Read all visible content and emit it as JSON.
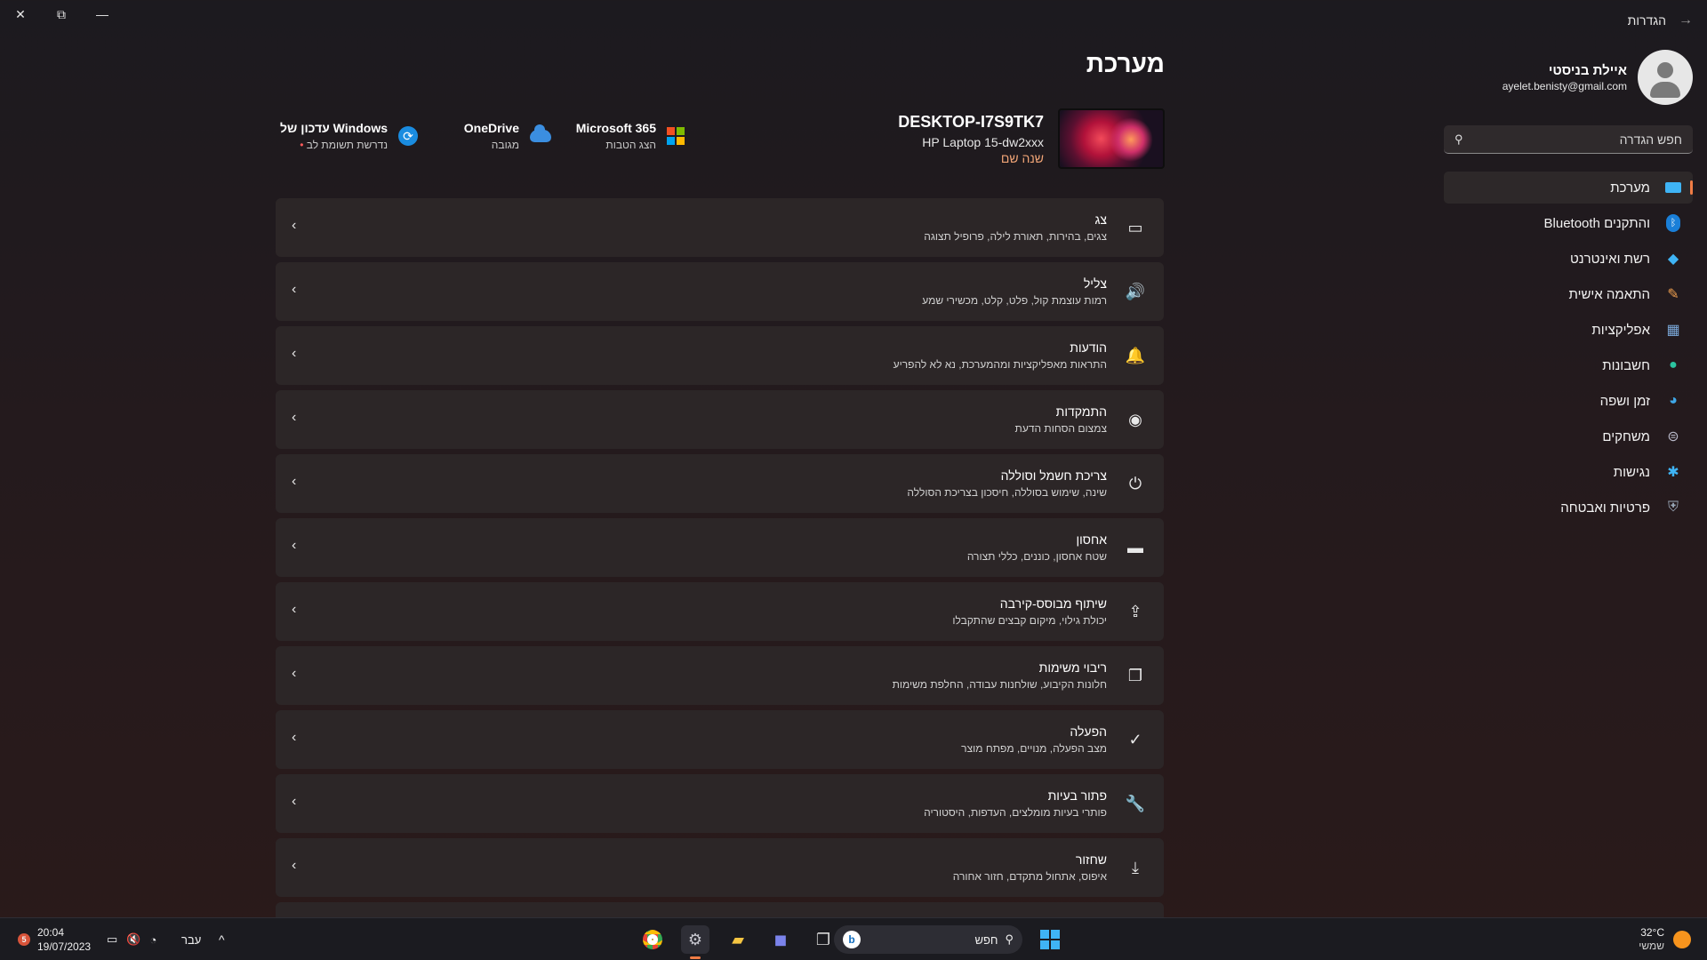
{
  "window": {
    "app_title": "הגדרות",
    "back_glyph": "→",
    "close_glyph": "✕",
    "maximize_glyph": "⧉",
    "minimize_glyph": "—"
  },
  "user": {
    "name": "איילת בניסטי",
    "email": "ayelet.benisty@gmail.com"
  },
  "search": {
    "placeholder": "חפש הגדרה"
  },
  "nav": {
    "items": [
      {
        "label": "מערכת",
        "icon": "system-icon",
        "active": true
      },
      {
        "label": "Bluetooth והתקנים",
        "icon": "bluetooth-icon"
      },
      {
        "label": "רשת ואינטרנט",
        "icon": "wifi-icon"
      },
      {
        "label": "התאמה אישית",
        "icon": "brush-icon"
      },
      {
        "label": "אפליקציות",
        "icon": "apps-icon"
      },
      {
        "label": "חשבונות",
        "icon": "person-icon"
      },
      {
        "label": "זמן ושפה",
        "icon": "globe-clock-icon"
      },
      {
        "label": "משחקים",
        "icon": "gamepad-icon"
      },
      {
        "label": "נגישות",
        "icon": "accessibility-icon"
      },
      {
        "label": "פרטיות ואבטחה",
        "icon": "shield-icon"
      }
    ]
  },
  "main": {
    "title": "מערכת",
    "device": {
      "name": "DESKTOP-I7S9TK7",
      "model": "HP Laptop 15-dw2xxx",
      "rename_link": "שנה שם"
    },
    "quick": {
      "ms365": {
        "title": "Microsoft 365",
        "subtitle": "הצג הטבות"
      },
      "onedrive": {
        "title": "OneDrive",
        "subtitle": "מגובה"
      },
      "winupdate": {
        "title": "עדכון של Windows",
        "subtitle": "נדרשת תשומת לב",
        "dot": "•"
      }
    },
    "rows": [
      {
        "title": "צג",
        "subtitle": "צגים, בהירות, תאורת לילה, פרופיל תצוגה",
        "icon": "display-icon",
        "glyph": "▭"
      },
      {
        "title": "צליל",
        "subtitle": "רמות עוצמת קול, פלט, קלט, מכשירי שמע",
        "icon": "speaker-icon",
        "glyph": "🔊"
      },
      {
        "title": "הודעות",
        "subtitle": "התראות מאפליקציות ומהמערכת, נא לא להפריע",
        "icon": "bell-icon",
        "glyph": "🔔"
      },
      {
        "title": "התמקדות",
        "subtitle": "צמצום הסחות הדעת",
        "icon": "focus-icon",
        "glyph": "◉"
      },
      {
        "title": "צריכת חשמל וסוללה",
        "subtitle": "שינה, שימוש בסוללה, חיסכון בצריכת הסוללה",
        "icon": "power-icon",
        "glyph": "⏻"
      },
      {
        "title": "אחסון",
        "subtitle": "שטח אחסון, כוננים, כללי תצורה",
        "icon": "storage-icon",
        "glyph": "▬"
      },
      {
        "title": "שיתוף מבוסס-קירבה",
        "subtitle": "יכולת גילוי, מיקום קבצים שהתקבלו",
        "icon": "share-icon",
        "glyph": "⇪"
      },
      {
        "title": "ריבוי משימות",
        "subtitle": "חלונות הקיבוע, שולחנות עבודה, החלפת משימות",
        "icon": "multitask-icon",
        "glyph": "❐"
      },
      {
        "title": "הפעלה",
        "subtitle": "מצב הפעלה, מנויים, מפתח מוצר",
        "icon": "check-circle-icon",
        "glyph": "✓"
      },
      {
        "title": "פתור בעיות",
        "subtitle": "פותרי בעיות מומלצים, העדפות, היסטוריה",
        "icon": "wrench-icon",
        "glyph": "🔧"
      },
      {
        "title": "שחזור",
        "subtitle": "איפוס, אתחול מתקדם, חזור אחורה",
        "icon": "recovery-icon",
        "glyph": "⤓"
      }
    ],
    "chevron": "‹"
  },
  "taskbar": {
    "notif_count": "5",
    "time": "20:04",
    "date": "19/07/2023",
    "language": "עבר",
    "chevron_up": "^",
    "search_placeholder": "חפש",
    "bing_glyph": "b",
    "weather_temp": "32°C",
    "weather_desc": "שמשי"
  },
  "colors": {
    "accent": "#f07c45",
    "link": "#f0a476"
  }
}
